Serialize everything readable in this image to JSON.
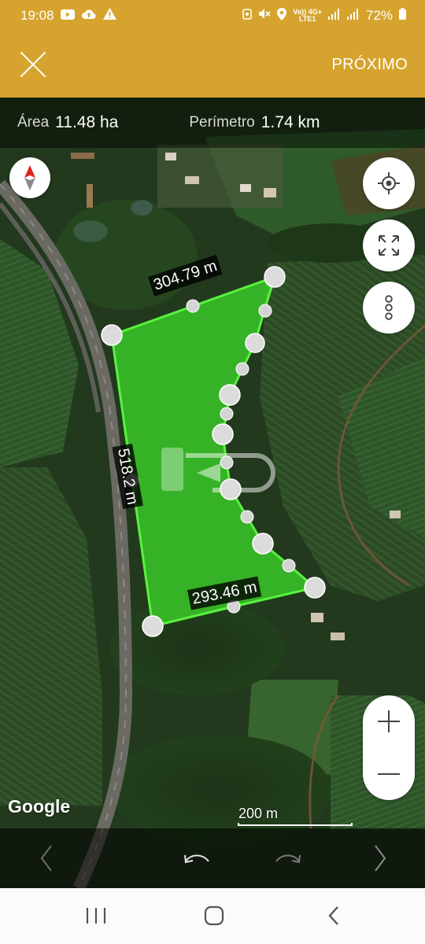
{
  "status_bar": {
    "time": "19:08",
    "battery_percent": "72%",
    "network_top": "Vo)) 4G+",
    "network_bottom": "LTE1"
  },
  "app_bar": {
    "next_label": "PRÓXIMO"
  },
  "measurements": {
    "area_label": "Área",
    "area_value": "11.48 ha",
    "perimeter_label": "Perímetro",
    "perimeter_value": "1.74 km"
  },
  "polygon": {
    "fill_color": "#3ee02b",
    "edge_labels": {
      "top": "304.79 m",
      "left": "518.2 m",
      "bottom": "293.46 m"
    }
  },
  "map": {
    "attribution": "Google",
    "scale_label": "200 m"
  },
  "icons": {
    "compass": "compass-icon",
    "my_location": "crosshair-icon",
    "fit_bounds": "expand-icon",
    "more": "more-vertical-icon",
    "zoom_in": "plus-icon",
    "zoom_out": "minus-icon",
    "undo": "undo-icon",
    "redo": "redo-icon",
    "previous": "chevron-left-icon",
    "next": "chevron-right-icon"
  }
}
